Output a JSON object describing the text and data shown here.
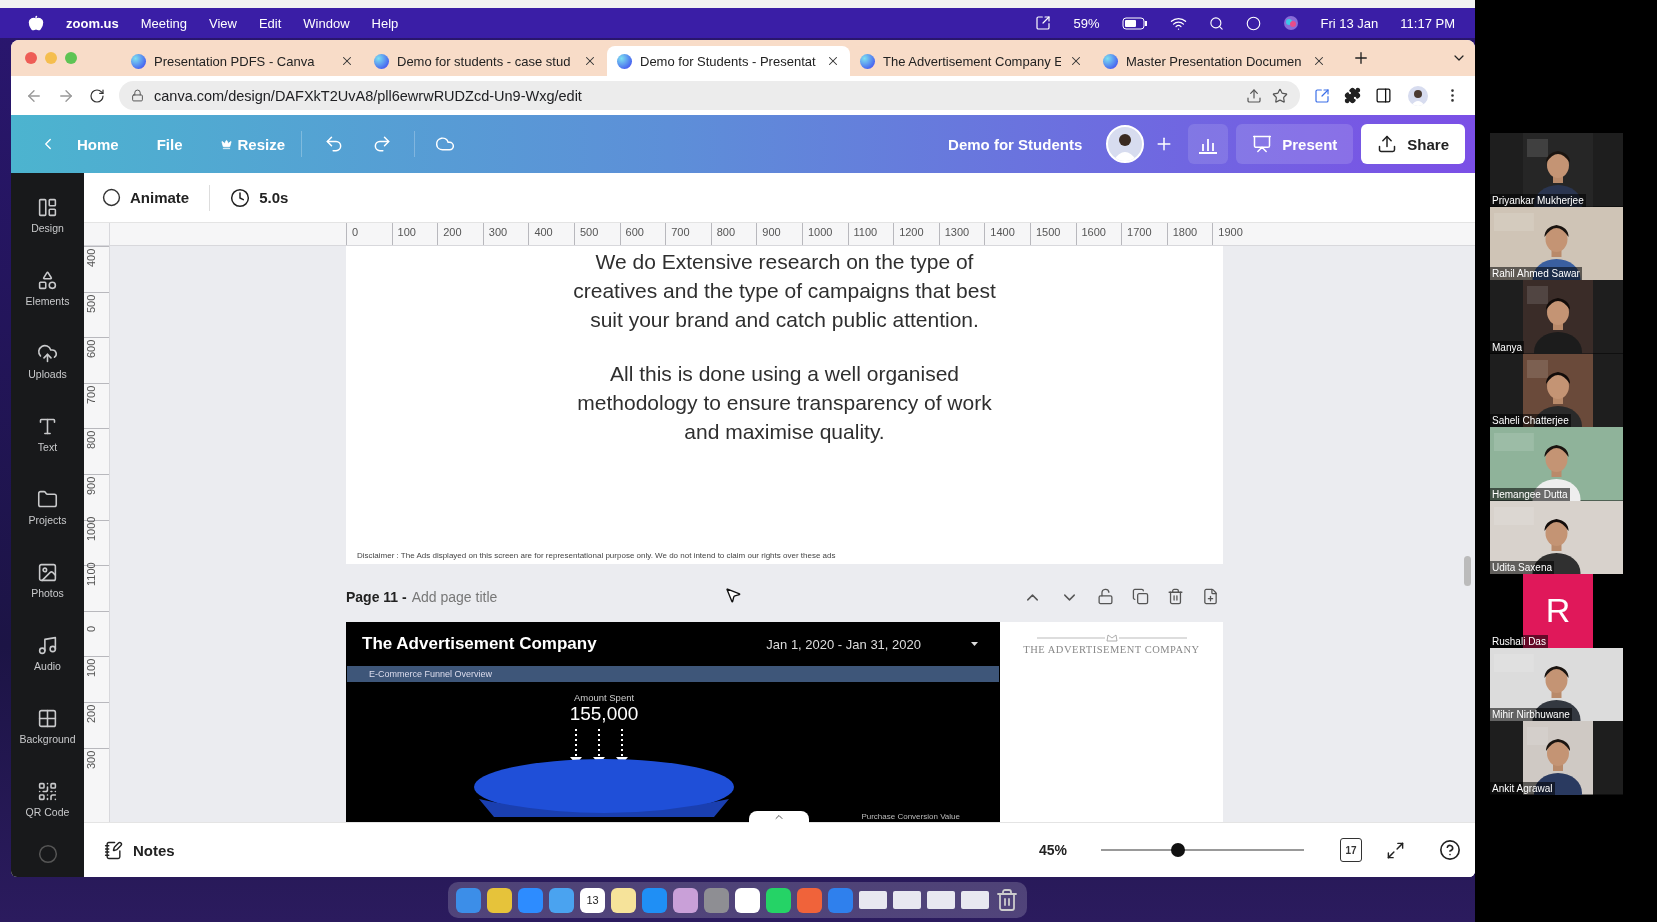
{
  "menu_bar": {
    "app": "zoom.us",
    "menus": [
      "Meeting",
      "View",
      "Edit",
      "Window",
      "Help"
    ],
    "battery": "59%",
    "date": "Fri 13 Jan",
    "time": "11:17 PM"
  },
  "browser": {
    "tabs": [
      {
        "title": "Presentation PDFS - Canva",
        "selected": false
      },
      {
        "title": "Demo for students - case stud",
        "selected": false
      },
      {
        "title": "Demo for Students - Presentat",
        "selected": true
      },
      {
        "title": "The Advertisement Company E",
        "selected": false
      },
      {
        "title": "Master Presentation Documen",
        "selected": false
      }
    ],
    "url": "canva.com/design/DAFXkT2UvA8/pll6ewrwRUDZcd-Un9-Wxg/edit"
  },
  "canva": {
    "header": {
      "home": "Home",
      "file": "File",
      "resize": "Resize",
      "design_title": "Demo for Students",
      "present": "Present",
      "share": "Share"
    },
    "sidebar": [
      {
        "label": "Design",
        "kind": "design"
      },
      {
        "label": "Elements",
        "kind": "elements"
      },
      {
        "label": "Uploads",
        "kind": "uploads"
      },
      {
        "label": "Text",
        "kind": "text"
      },
      {
        "label": "Projects",
        "kind": "projects"
      },
      {
        "label": "Photos",
        "kind": "photos"
      },
      {
        "label": "Audio",
        "kind": "audio"
      },
      {
        "label": "Background",
        "kind": "background"
      },
      {
        "label": "QR Code",
        "kind": "qrcode"
      }
    ],
    "toolbar": {
      "animate": "Animate",
      "duration": "5.0s"
    },
    "ruler": {
      "horizontal": [
        "0",
        "100",
        "200",
        "300",
        "400",
        "500",
        "600",
        "700",
        "800",
        "900",
        "1000",
        "1100",
        "1200",
        "1300",
        "1400",
        "1500",
        "1600",
        "1700",
        "1800",
        "1900"
      ],
      "vertical": [
        "400",
        "500",
        "600",
        "700",
        "800",
        "900",
        "1000",
        "1100",
        "0",
        "100",
        "200",
        "300"
      ]
    },
    "previous_page": {
      "paragraphs": [
        [
          "We do Extensive research on the type of",
          "creatives and the type of campaigns that best",
          "suit your brand and catch public attention."
        ],
        [
          "All this is done using a well organised",
          "methodology to ensure transparency of work",
          "and maximise quality."
        ]
      ],
      "disclaimer": "Disclaimer : The Ads displayed on this screen are for representational purpose only. We do not intend to claim our rights over these ads"
    },
    "page": {
      "number": "Page 11 -",
      "title_placeholder": "Add page title",
      "slide": {
        "company": "The Advertisement Company",
        "date_range": "Jan 1, 2020 - Jan 31, 2020",
        "section": "E-Commerce Funnel Overview",
        "metric_label": "Amount Spent",
        "metric_value": "155,000",
        "footer_label": "Purchase Conversion Value",
        "logo_text": "THE ADVERTISEMENT COMPANY"
      }
    },
    "bottom_bar": {
      "notes": "Notes",
      "zoom": "45%",
      "zoom_slider": {
        "level": 0.38
      },
      "page_count": "17"
    }
  },
  "dock": [
    {
      "kind": "finder"
    },
    {
      "kind": "chrome"
    },
    {
      "kind": "zoom"
    },
    {
      "kind": "mail"
    },
    {
      "kind": "calendar",
      "label": "13"
    },
    {
      "kind": "notes"
    },
    {
      "kind": "appstore"
    },
    {
      "kind": "launchpad"
    },
    {
      "kind": "settings"
    },
    {
      "kind": "slack"
    },
    {
      "kind": "whatsapp"
    },
    {
      "kind": "brave"
    },
    {
      "kind": "safari"
    },
    {
      "kind": "window"
    },
    {
      "kind": "window"
    },
    {
      "kind": "window"
    },
    {
      "kind": "window"
    },
    {
      "kind": "trash"
    }
  ],
  "participants": [
    {
      "name": "Priyankar Mukherjee",
      "kind": "video"
    },
    {
      "name": "Rahil Ahmed Sawar",
      "kind": "video"
    },
    {
      "name": "Manya",
      "kind": "video"
    },
    {
      "name": "Saheli Chatterjee",
      "kind": "video"
    },
    {
      "name": "Hemangee Dutta",
      "kind": "video"
    },
    {
      "name": "Udita Saxena",
      "kind": "video"
    },
    {
      "name": "Rushali Das",
      "kind": "avatar",
      "initial": "R"
    },
    {
      "name": "Mihir Nirbhuwane",
      "kind": "video"
    },
    {
      "name": "Ankit Agrawal",
      "kind": "video"
    }
  ]
}
